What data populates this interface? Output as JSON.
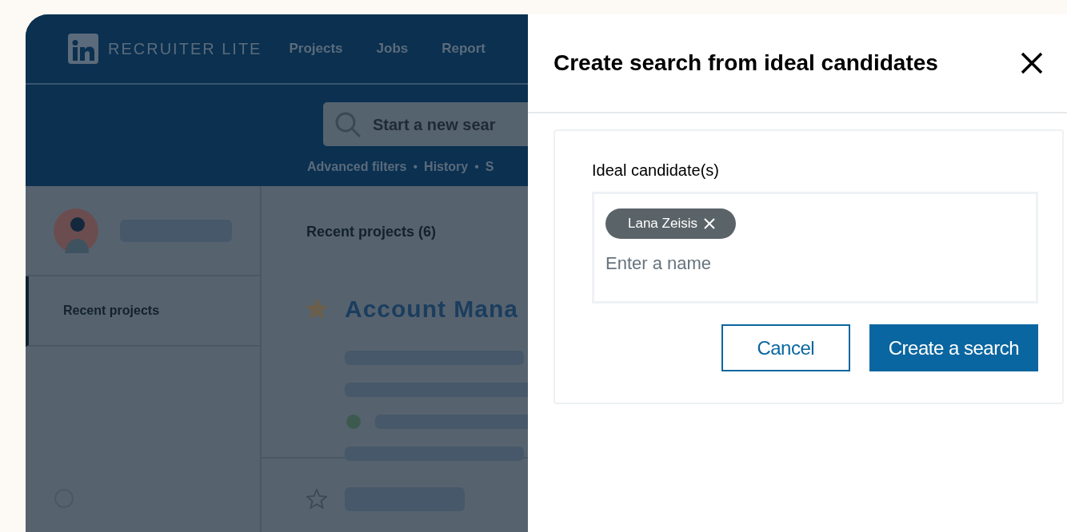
{
  "app": {
    "brand": "RECRUITER LITE",
    "nav": [
      {
        "label": "Projects"
      },
      {
        "label": "Jobs"
      },
      {
        "label": "Report"
      }
    ],
    "search": {
      "placeholder": "Start a new sear"
    },
    "search_links": {
      "separator": "•",
      "items": [
        "Advanced filters",
        "History",
        "S"
      ]
    },
    "sidebar": {
      "items": [
        {
          "label": "Recent projects",
          "selected": true
        }
      ]
    },
    "main": {
      "heading": "Recent projects (6)",
      "projects": [
        {
          "title": "Account Mana",
          "starred": true
        },
        {
          "starred": false
        }
      ]
    }
  },
  "dialog": {
    "title": "Create search from ideal candidates",
    "field": {
      "label": "Ideal candidate(s)",
      "chips": [
        {
          "label": "Lana Zeisis"
        }
      ],
      "placeholder": "Enter a name"
    },
    "buttons": [
      {
        "label": "Cancel",
        "kind": "secondary"
      },
      {
        "label": "Create a search",
        "kind": "primary"
      }
    ]
  }
}
